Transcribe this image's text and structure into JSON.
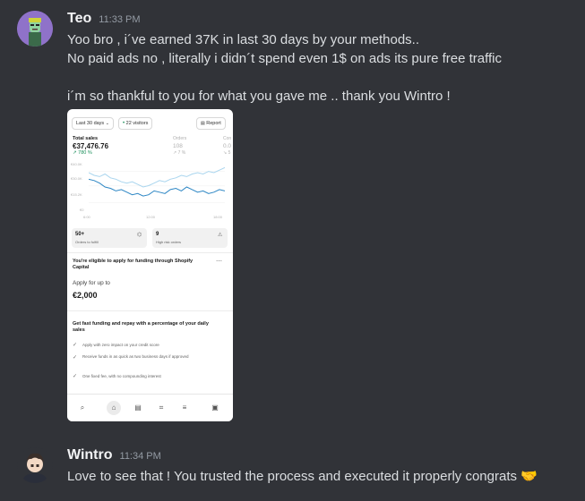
{
  "messages": [
    {
      "author": "Teo",
      "timestamp": "11:33 PM",
      "lines": [
        "Yoo bro , i´ve earned 37K in last 30 days by your methods..",
        "No paid ads no , literally i didn´t spend even 1$ on ads its pure free traffic",
        "i´m so thankful to you for what you gave me .. thank you Wintro !"
      ],
      "avatar_color": "#8f72c9"
    },
    {
      "author": "Wintro",
      "timestamp": "11:34 PM",
      "lines": [
        "Love to see that !  You trusted the process and executed it properly congrats 🤝"
      ]
    }
  ],
  "attachment": {
    "range_pill": "Last 30 days",
    "visitors_pill": "22 visitors",
    "report_button": "Report",
    "total_sales_label": "Total sales",
    "total_sales_value": "€37,476.76",
    "total_sales_change": "↗ 780 %",
    "orders_label": "Orders",
    "orders_value": "108",
    "orders_change": "↗ 7 %",
    "conv_label": "Con",
    "conv_value": "0.0",
    "conv_change": "↘ 5",
    "y_ticks": [
      "€40.0K",
      "€30.0K",
      "€15.2K",
      "€0"
    ],
    "x_ticks": [
      "6:00",
      "12:00",
      "18:00"
    ],
    "card1_value": "50+",
    "card1_label": "Orders to fulfill",
    "card2_value": "9",
    "card2_label": "High risk orders",
    "funding_title": "You're eligible to apply for funding through Shopify Capital",
    "apply_label": "Apply for up to",
    "apply_amount": "€2,000",
    "fast_title": "Get fast funding and repay with a percentage of your daily sales",
    "bullets": [
      "Apply with zero impact on your credit score",
      "Receive funds in as quick as two business days if approved",
      "One fixed fee, with no compounding interest"
    ],
    "chart_lines": {
      "current": [
        31,
        29,
        28,
        30,
        27,
        26,
        24,
        23,
        24,
        22,
        20,
        21,
        23,
        25,
        24,
        26,
        27,
        29,
        28,
        30,
        31,
        30,
        32,
        31,
        33,
        35
      ],
      "previous": [
        26,
        25,
        23,
        20,
        19,
        17,
        18,
        16,
        14,
        15,
        13,
        14,
        17,
        16,
        15,
        18,
        19,
        17,
        20,
        18,
        16,
        17,
        15,
        16,
        18,
        17
      ]
    }
  }
}
